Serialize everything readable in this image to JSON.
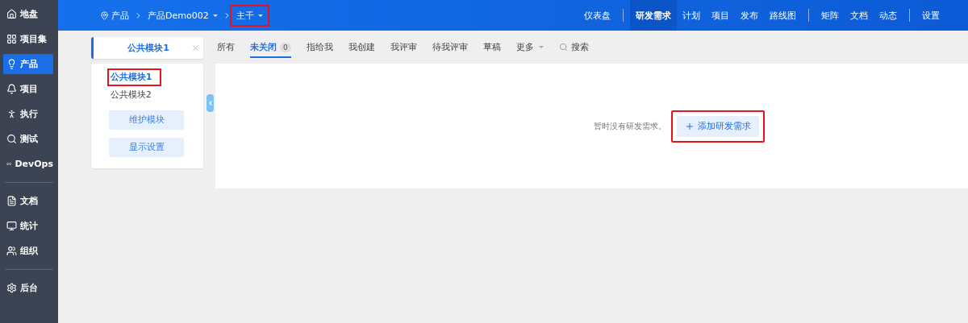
{
  "sidebar": {
    "groups": [
      {
        "items": [
          {
            "label": "地盘",
            "selected": false
          },
          {
            "label": "项目集",
            "selected": false
          },
          {
            "label": "产品",
            "selected": true
          },
          {
            "label": "项目",
            "selected": false
          },
          {
            "label": "执行",
            "selected": false
          },
          {
            "label": "测试",
            "selected": false
          },
          {
            "label": "DevOps",
            "selected": false
          }
        ]
      },
      {
        "items": [
          {
            "label": "文档",
            "selected": false
          },
          {
            "label": "统计",
            "selected": false
          },
          {
            "label": "组织",
            "selected": false
          }
        ]
      },
      {
        "items": [
          {
            "label": "后台",
            "selected": false
          }
        ]
      }
    ]
  },
  "breadcrumb": [
    {
      "label": "产品",
      "kind": "home",
      "highlighted": false
    },
    {
      "label": "产品Demo002",
      "kind": "dropdown",
      "highlighted": false
    },
    {
      "label": "主干",
      "kind": "dropdown",
      "highlighted": true
    }
  ],
  "nav": {
    "groups": [
      {
        "items": [
          {
            "label": "仪表盘",
            "selected": false
          }
        ]
      },
      {
        "items": [
          {
            "label": "研发需求",
            "selected": true
          },
          {
            "label": "计划",
            "selected": false
          },
          {
            "label": "项目",
            "selected": false
          },
          {
            "label": "发布",
            "selected": false
          },
          {
            "label": "路线图",
            "selected": false
          }
        ]
      },
      {
        "items": [
          {
            "label": "矩阵",
            "selected": false
          },
          {
            "label": "文档",
            "selected": false
          },
          {
            "label": "动态",
            "selected": false
          }
        ]
      },
      {
        "items": [
          {
            "label": "设置",
            "selected": false
          }
        ]
      }
    ]
  },
  "module_tab": {
    "label": "公共模块1"
  },
  "modules": [
    {
      "label": "公共模块1",
      "selected": true,
      "highlighted": true
    },
    {
      "label": "公共模块2",
      "selected": false,
      "highlighted": false
    }
  ],
  "module_buttons": [
    "维护模块",
    "显示设置"
  ],
  "filters": [
    {
      "label": "所有",
      "kind": "tab",
      "selected": false
    },
    {
      "label": "未关闭",
      "kind": "tab",
      "selected": true,
      "count": "0"
    },
    {
      "label": "指给我",
      "kind": "tab",
      "selected": false
    },
    {
      "label": "我创建",
      "kind": "tab",
      "selected": false
    },
    {
      "label": "我评审",
      "kind": "tab",
      "selected": false
    },
    {
      "label": "待我评审",
      "kind": "tab",
      "selected": false
    },
    {
      "label": "草稿",
      "kind": "tab",
      "selected": false
    },
    {
      "label": "更多",
      "kind": "dropdown",
      "selected": false
    },
    {
      "label": "搜索",
      "kind": "search",
      "selected": false
    }
  ],
  "empty": {
    "message": "暂时没有研发需求。",
    "button": {
      "label": "添加研发需求",
      "highlighted": true
    }
  }
}
